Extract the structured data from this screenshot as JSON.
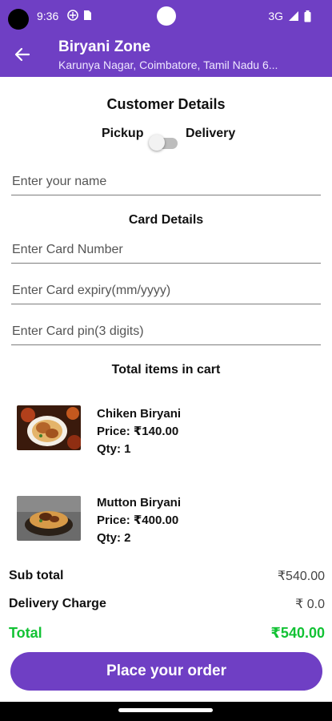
{
  "status_bar": {
    "time": "9:36",
    "network": "3G"
  },
  "app_bar": {
    "title": "Biryani Zone",
    "subtitle": "Karunya Nagar, Coimbatore, Tamil Nadu 6..."
  },
  "customer": {
    "section_title": "Customer Details",
    "pickup_label": "Pickup",
    "delivery_label": "Delivery",
    "delivery_toggle_on": false,
    "name_placeholder": "Enter your name"
  },
  "card": {
    "section_title": "Card Details",
    "number_placeholder": "Enter Card Number",
    "expiry_placeholder": "Enter Card expiry(mm/yyyy)",
    "pin_placeholder": "Enter Card pin(3 digits)"
  },
  "cart": {
    "title": "Total items in cart",
    "items": [
      {
        "name": "Chiken Biryani",
        "price": "Price: ₹140.00",
        "qty": "Qty: 1",
        "image_icon": "chicken-biryani-photo"
      },
      {
        "name": "Mutton Biryani",
        "price": "Price: ₹400.00",
        "qty": "Qty: 2",
        "image_icon": "mutton-biryani-photo"
      }
    ]
  },
  "summary": {
    "subtotal_label": "Sub total",
    "subtotal_value": "₹540.00",
    "delivery_label": "Delivery Charge",
    "delivery_value": "₹ 0.0",
    "total_label": "Total",
    "total_value": "₹540.00"
  },
  "order_button": "Place your order",
  "colors": {
    "primary": "#6f3fc4",
    "total": "#12c234"
  }
}
